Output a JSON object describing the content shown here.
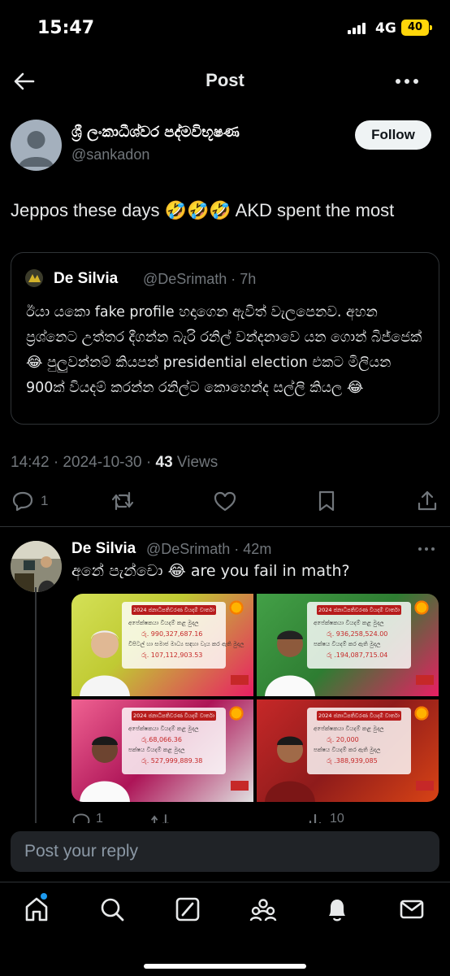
{
  "status_bar": {
    "time": "15:47",
    "network": "4G",
    "battery": "40"
  },
  "header": {
    "title": "Post"
  },
  "post": {
    "author_name": "ශ්‍රී ලංකාධීශ්වර පද්මවිභූෂණ",
    "author_handle": "@sankadon",
    "follow_label": "Follow",
    "text": "Jeppos these days 🤣🤣🤣 AKD spent the most",
    "timestamp": "14:42 · 2024-10-30 · ",
    "views_count": "43",
    "views_label": " Views",
    "stats": {
      "replies": "1"
    }
  },
  "quote": {
    "name": "De Silvia",
    "meta": "@DeSrimath · 7h",
    "text": "ඊයා යකො fake profile හදාගෙන ඇවිත් වැලපෙනව. අහන ප්‍රශ්නෙට උත්තර දීගන්න බැරි රනිල් වන්දනාවෙ යන ගොන් බිජ්ජෙක් 😂 පුලුවන්නම් කියපන් presidential election එකට මිලියන 900ක් වියදම් කරන්න රනිල්ට කොහෙන්ද සල්ලි කියල 😂"
  },
  "reply": {
    "name": "De Silvia",
    "meta": "@DeSrimath · 42m",
    "text": "අනේ පැන්චො 😂 are you fail in math?",
    "stats": {
      "replies": "1",
      "views": "10"
    }
  },
  "image_grid": {
    "tiles": [
      {
        "header": "2024 ජනාධිපතිවරණ වියදම් වාර්තා",
        "candidate_label": "අපේක්ෂකයා වියදම් කළ මුදල",
        "candidate_amount": "රු. 990,327,687.16",
        "party_label": "විපිටල් හා සමාජ මාධ්‍ය සඳහා වැය කර ඇති මුදල",
        "party_amount": "රු. 107,112,903.53",
        "bg": "#9acd32"
      },
      {
        "header": "2024 ජනාධිපතිවරණ වියදම් වාර්තා",
        "candidate_label": "අපේක්ෂකයා වියදම් කළ මුදල",
        "candidate_amount": "රු. 936,258,524.00",
        "party_label": "පක්ෂය වියදම් කර ඇති මුදල",
        "party_amount": "රු .194,087,715.04",
        "bg": "#2e7d32"
      },
      {
        "header": "2024 ජනාධිපතිවරණ වියදම් වාර්තා",
        "candidate_label": "අපේක්ෂකයා වියදම් කළ මුදල",
        "candidate_amount": "රු.68,066.36",
        "party_label": "පක්ෂය වියදම් කළ මුදල",
        "party_amount": "රු. 527,999,889.38",
        "bg": "#ad1457"
      },
      {
        "header": "2024 ජනාධිපතිවරණ වියදම් වාර්තා",
        "candidate_label": "අපේක්ෂකයා වියදම් කළ මුදල",
        "candidate_amount": "රු. 20,000",
        "party_label": "පක්ෂය වියදම් කර ඇති මුදල",
        "party_amount": "රු .388,939,085",
        "bg": "#8e1b1b"
      }
    ]
  },
  "composer": {
    "placeholder": "Post your reply"
  },
  "colors": {
    "accent": "#1d9bf0",
    "background": "#000000",
    "muted": "#71767b",
    "battery": "#ffd60a"
  },
  "tab_bar": {
    "items": [
      "home-icon",
      "search-icon",
      "grok-icon",
      "communities-icon",
      "notifications-icon",
      "messages-icon"
    ]
  }
}
